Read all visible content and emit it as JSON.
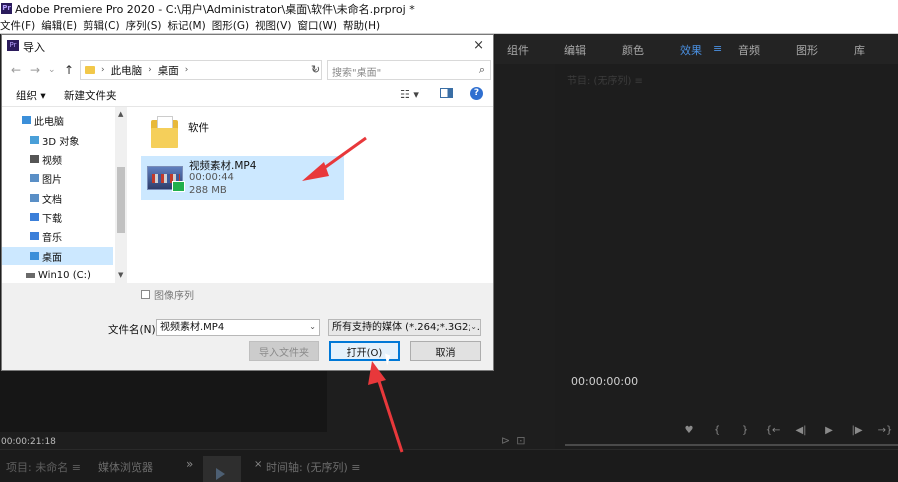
{
  "app": {
    "window_title": "Adobe Premiere Pro 2020 - C:\\用户\\Administrator\\桌面\\软件\\未命名.prproj *",
    "logo_text": "Pr"
  },
  "menubar": {
    "items": [
      "文件(F)",
      "编辑(E)",
      "剪辑(C)",
      "序列(S)",
      "标记(M)",
      "图形(G)",
      "视图(V)",
      "窗口(W)",
      "帮助(H)"
    ]
  },
  "workspace_tabs": {
    "items": [
      {
        "label": "组件",
        "active": false
      },
      {
        "label": "编辑",
        "active": false
      },
      {
        "label": "颜色",
        "active": false
      },
      {
        "label": "效果",
        "active": true
      },
      {
        "label": "音频",
        "active": false
      },
      {
        "label": "图形",
        "active": false
      },
      {
        "label": "库",
        "active": false
      }
    ],
    "menu_glyph": "≡"
  },
  "program_monitor": {
    "title": "节目: (无序列) ≡",
    "timecode": "00:00:00:00",
    "controls": [
      "♥",
      "{",
      "}",
      "{←",
      "◀|",
      "▶",
      "|▶",
      "→}"
    ]
  },
  "source_panel": {
    "timecode": "00:00:21:18"
  },
  "bottom_panels": {
    "project_tab": "项目: 未命名 ≡",
    "media_browser_tab": "媒体浏览器",
    "more": "»",
    "timeline_close": "×",
    "timeline_tab": "时间轴: (无序列) ≡"
  },
  "dialog": {
    "title": "导入",
    "close": "×",
    "nav": {
      "back": "←",
      "forward": "→",
      "recent": "⌄",
      "up": "↑"
    },
    "breadcrumb": [
      "此电脑",
      "桌面"
    ],
    "search_placeholder": "搜索\"桌面\"",
    "toolbar": {
      "organize": "组织 ▾",
      "new_folder": "新建文件夹"
    },
    "nav_items": [
      {
        "label": "此电脑",
        "color": "#3b8fd9",
        "selected": false
      },
      {
        "label": "3D 对象",
        "color": "#4a9fd8",
        "selected": false
      },
      {
        "label": "视频",
        "color": "#555555",
        "selected": false
      },
      {
        "label": "图片",
        "color": "#5a8fc6",
        "selected": false
      },
      {
        "label": "文档",
        "color": "#5a8fc6",
        "selected": false
      },
      {
        "label": "下载",
        "color": "#3b7fd9",
        "selected": false
      },
      {
        "label": "音乐",
        "color": "#3b7fd9",
        "selected": false
      },
      {
        "label": "桌面",
        "color": "#3b8fd9",
        "selected": true
      },
      {
        "label": "Win10 (C:)",
        "color": "#6a6a6a",
        "selected": false
      }
    ],
    "folder": {
      "name": "软件"
    },
    "video": {
      "name": "视频素材.MP4",
      "duration": "00:00:44",
      "size": "288 MB"
    },
    "image_sequence_label": "图像序列",
    "filename_label": "文件名(N):",
    "filename_value": "视频素材.MP4",
    "filetype_value": "所有支持的媒体 (*.264;*.3G2;*.",
    "buttons": {
      "import_folder": "导入文件夹",
      "open": "打开(O)",
      "cancel": "取消"
    }
  },
  "colors": {
    "accent_blue": "#4a90e2",
    "annotation_red": "#e8383b",
    "selection": "#cce8ff"
  }
}
